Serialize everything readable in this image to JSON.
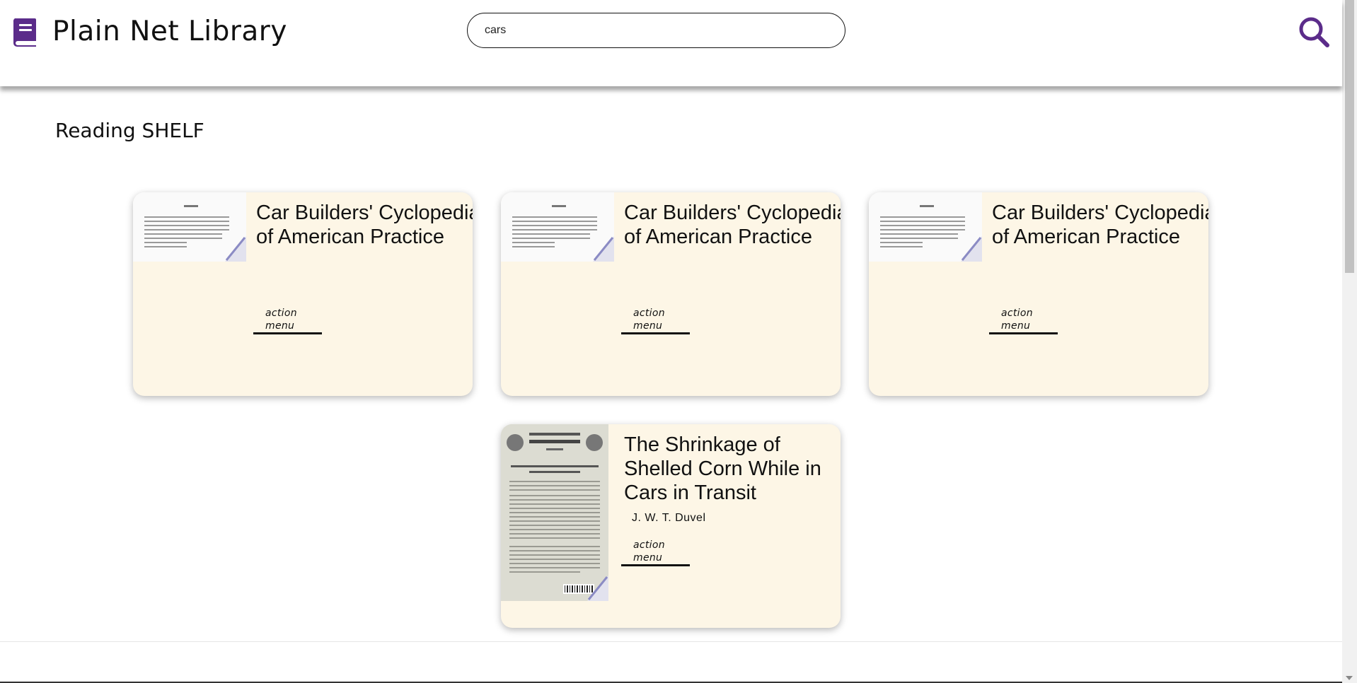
{
  "app": {
    "title": "Plain Net Library",
    "brand_color": "#5b2c8a"
  },
  "search": {
    "value": "cars",
    "placeholder": ""
  },
  "shelf": {
    "title": "Reading SHELF",
    "cards": [
      {
        "title": "Car Builders' Cyclopedia of American Practice",
        "author": "",
        "action_label": "action menu"
      },
      {
        "title": "Car Builders' Cyclopedia of American Practice",
        "author": "",
        "action_label": "action menu"
      },
      {
        "title": "Car Builders' Cyclopedia of American Practice",
        "author": "",
        "action_label": "action menu"
      },
      {
        "title": "The Shrinkage of Shelled Corn While in Cars in Transit",
        "author": "J. W. T. Duvel",
        "action_label": "action menu"
      }
    ]
  }
}
